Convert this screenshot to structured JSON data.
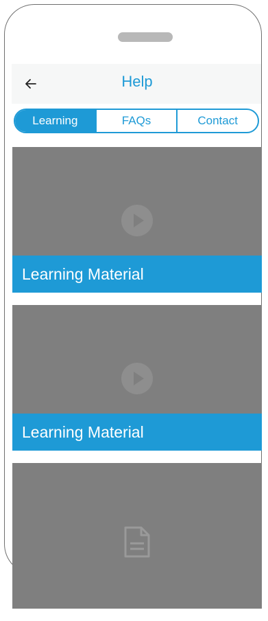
{
  "header": {
    "title": "Help",
    "back_icon": "arrow-left-icon"
  },
  "tabs": [
    {
      "label": "Learning",
      "active": true
    },
    {
      "label": "FAQs",
      "active": false
    },
    {
      "label": "Contact",
      "active": false
    }
  ],
  "cards": [
    {
      "caption": "Learning Material",
      "icon": "play-icon"
    },
    {
      "caption": "Learning Material",
      "icon": "play-icon"
    },
    {
      "caption": "",
      "icon": "document-icon"
    }
  ],
  "colors": {
    "accent": "#1e9ad6",
    "card_background": "#7f7f7f",
    "appbar_background": "#f6f7f7"
  }
}
